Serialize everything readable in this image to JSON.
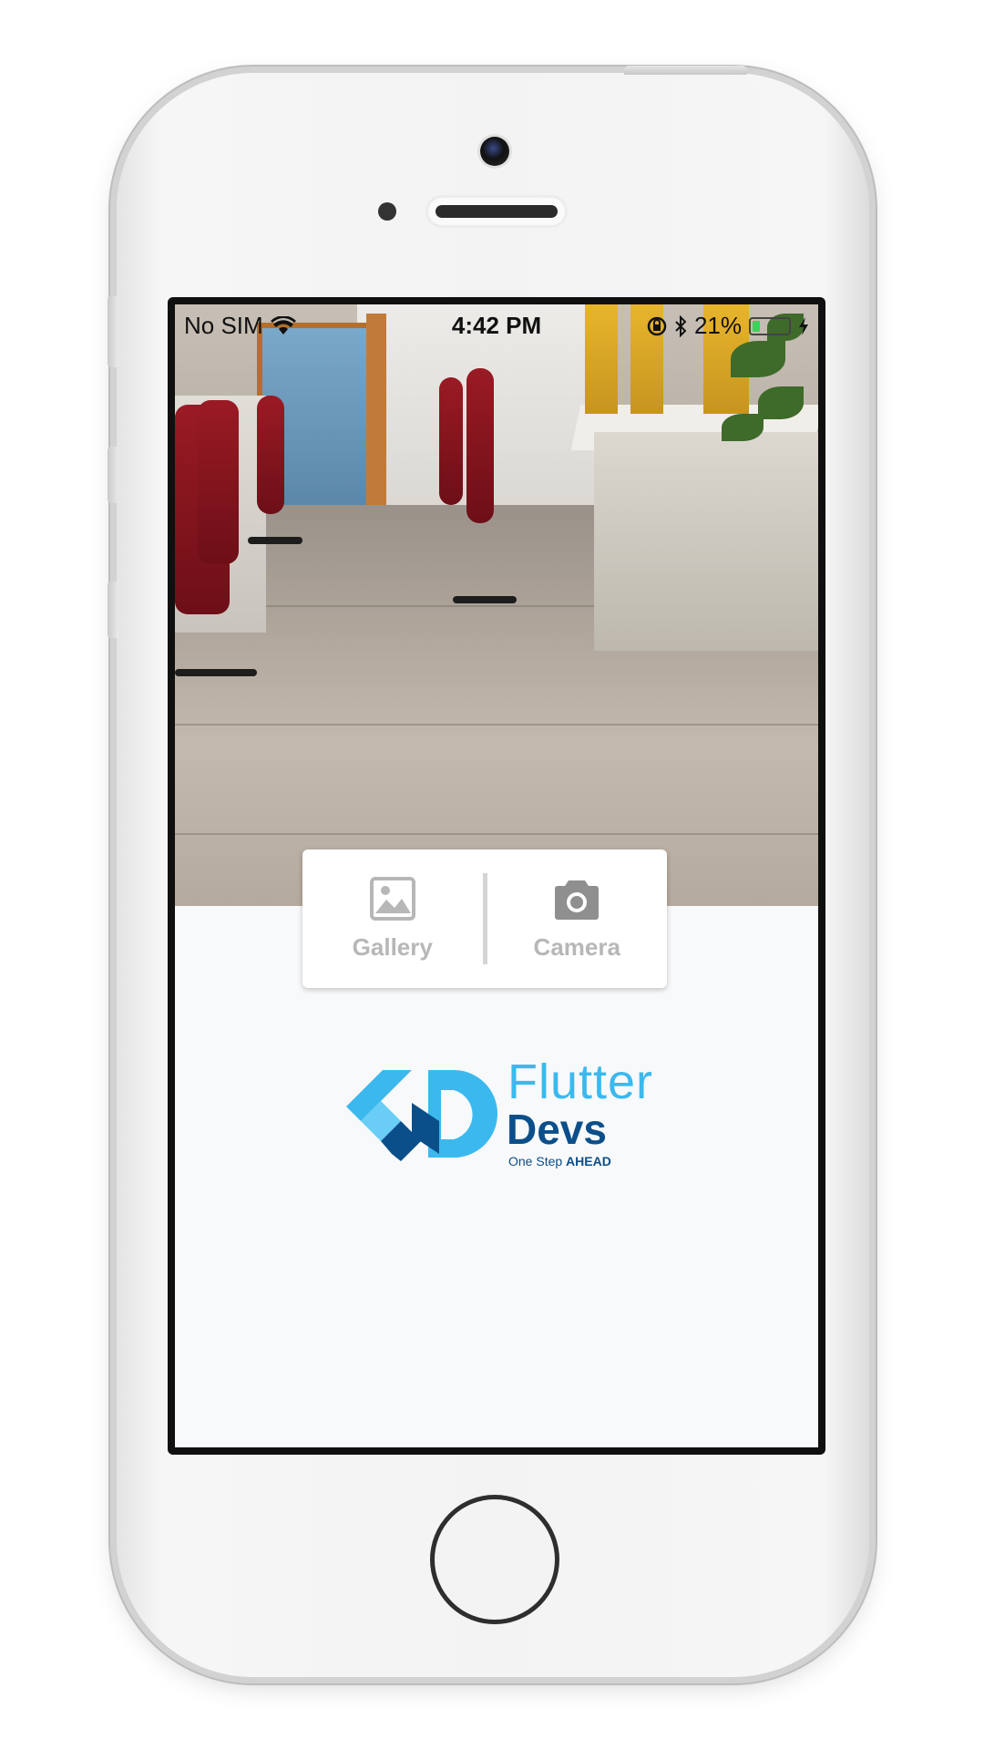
{
  "status_bar": {
    "carrier": "No SIM",
    "time": "4:42 PM",
    "battery_percent": "21%",
    "battery_level": 0.21
  },
  "picker": {
    "gallery_label": "Gallery",
    "camera_label": "Camera"
  },
  "logo": {
    "word_top": "Flutter",
    "word_bottom": "Devs",
    "tagline_start": "One Step",
    "tagline_bold": "AHEAD"
  },
  "colors": {
    "brand_light_blue": "#3bb9ee",
    "brand_dark_blue": "#0b4f8a",
    "battery_green": "#3fd15a"
  },
  "icons": {
    "gallery": "image-icon",
    "camera": "camera-icon",
    "wifi": "wifi-icon",
    "bluetooth": "bluetooth-icon",
    "orientation_lock": "orientation-lock-icon",
    "charging": "bolt-icon"
  }
}
